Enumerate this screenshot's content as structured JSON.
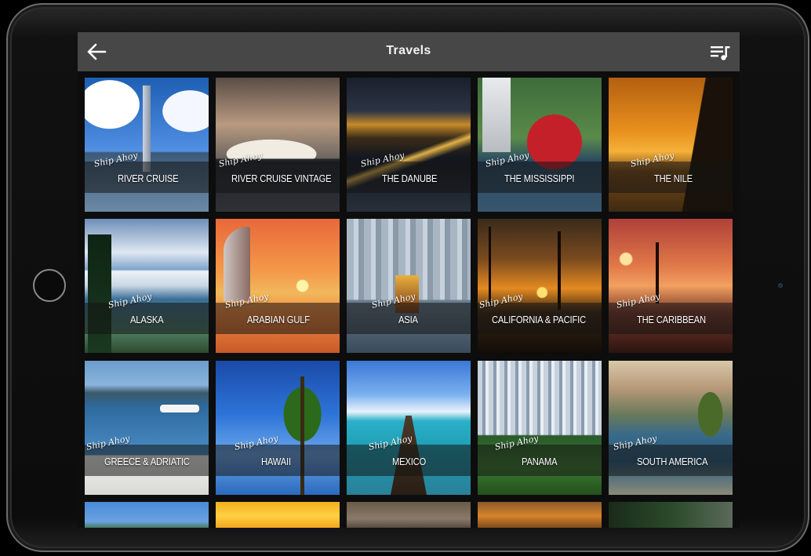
{
  "header": {
    "title": "Travels",
    "back_icon": "arrow-left-icon",
    "playlist_icon": "music-playlist-icon"
  },
  "tile_script_label": "Ship Ahoy",
  "destinations": [
    {
      "name": "RIVER CRUISE"
    },
    {
      "name": "RIVER CRUISE VINTAGE"
    },
    {
      "name": "THE DANUBE"
    },
    {
      "name": "THE MISSISSIPPI"
    },
    {
      "name": "THE NILE"
    },
    {
      "name": "ALASKA"
    },
    {
      "name": "ARABIAN GULF"
    },
    {
      "name": "ASIA"
    },
    {
      "name": "CALIFORNIA & PACIFIC"
    },
    {
      "name": "THE CARIBBEAN"
    },
    {
      "name": "GREECE & ADRIATIC"
    },
    {
      "name": "HAWAII"
    },
    {
      "name": "MEXICO"
    },
    {
      "name": "PANAMA"
    },
    {
      "name": "SOUTH AMERICA"
    }
  ],
  "colors": {
    "topbar": "#474747",
    "screen_bg": "#0d0d0d",
    "text": "#ffffff"
  }
}
